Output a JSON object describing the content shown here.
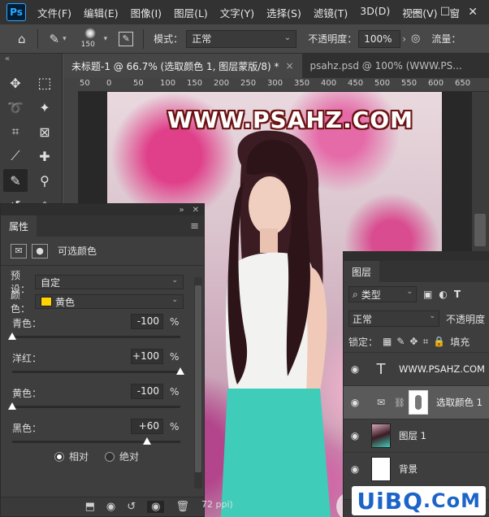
{
  "menu": {
    "logo": "Ps",
    "items": [
      "文件(F)",
      "编辑(E)",
      "图像(I)",
      "图层(L)",
      "文字(Y)",
      "选择(S)",
      "滤镜(T)",
      "3D(D)",
      "视图(V)",
      "窗"
    ],
    "window_controls": [
      "—",
      "☐",
      "✕"
    ]
  },
  "options": {
    "brush_size": "150",
    "mode_label": "模式：",
    "mode_value": "正常",
    "opacity_label": "不透明度：",
    "opacity_value": "100%",
    "flow_label": "流量："
  },
  "tabs": [
    {
      "label": "未标题-1 @ 66.7% (选取颜色 1, 图层蒙版/8) *",
      "close": "×"
    },
    {
      "label": "psahz.psd @ 100% (WWW.PS...",
      "close": ""
    }
  ],
  "ruler": {
    "labels": [
      "50",
      "0",
      "50",
      "100",
      "150",
      "200",
      "250",
      "300",
      "350",
      "400",
      "450",
      "500",
      "550",
      "600",
      "650"
    ]
  },
  "canvas": {
    "watermark": "WWW.PSAHZ.COM",
    "status_fragment": "72 ppi)"
  },
  "properties": {
    "tab": "属性",
    "title": "可选颜色",
    "preset_label": "预设：",
    "preset_value": "自定",
    "colors_label": "颜色：",
    "colors_value": "黄色",
    "sliders": [
      {
        "name": "青色：",
        "value": "-100",
        "unit": "%",
        "level": 0.0
      },
      {
        "name": "洋红：",
        "value": "+100",
        "unit": "%",
        "level": 1.0
      },
      {
        "name": "黄色：",
        "value": "-100",
        "unit": "%",
        "level": 0.0
      },
      {
        "name": "黑色：",
        "value": "+60",
        "unit": "%",
        "level": 0.8
      }
    ],
    "method_relative": "相对",
    "method_absolute": "绝对"
  },
  "layers": {
    "tab": "图层",
    "filter_value": "类型",
    "blend_value": "正常",
    "opacity_label": "不透明度",
    "lock_label": "锁定：",
    "fill_label": "填充",
    "items": [
      {
        "name": "WWW.PSAHZ.COM",
        "kind": "text"
      },
      {
        "name": "选取颜色 1",
        "kind": "adjustment"
      },
      {
        "name": "图层 1",
        "kind": "image"
      },
      {
        "name": "背景",
        "kind": "background"
      }
    ]
  },
  "logo": {
    "text_a": "UiBQ",
    "text_b": ".CoM"
  },
  "colors": {
    "accent": "#31a8ff",
    "swatch_yellow": "#ffd400",
    "watermark_outline": "#6b1212",
    "logo_blue": "#1c64c8"
  }
}
